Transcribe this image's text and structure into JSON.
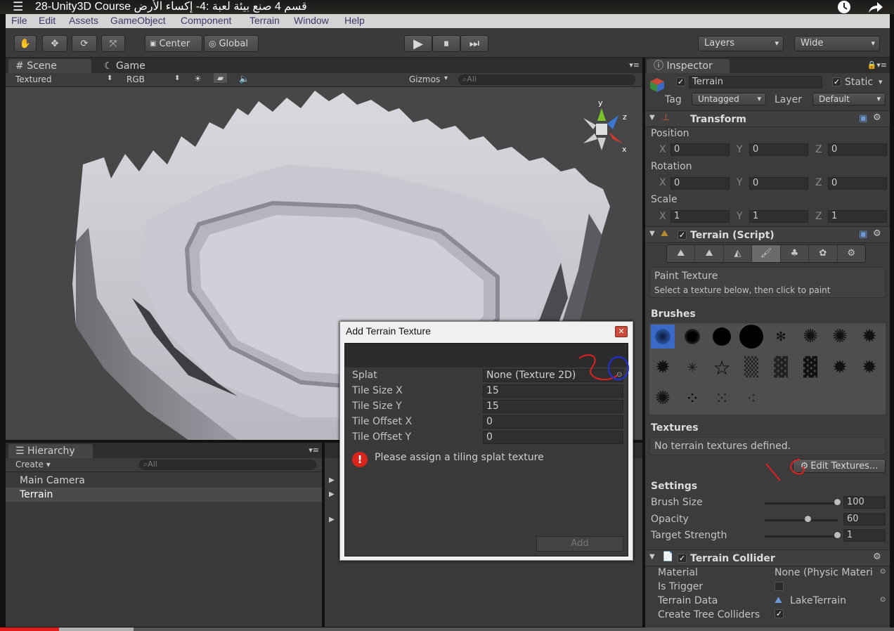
{
  "video": {
    "title": "28-Unity3D Course قسم 4 صنع بيئة لعبة :4- إكساء الأرض"
  },
  "menu": [
    "File",
    "Edit",
    "Assets",
    "GameObject",
    "Component",
    "Terrain",
    "Window",
    "Help"
  ],
  "toolbar": {
    "pivot": "Center",
    "space": "Global",
    "layers": "Layers",
    "layout": "Wide"
  },
  "scene": {
    "tab_scene": "Scene",
    "tab_game": "Game",
    "render_mode": "Textured",
    "color_mode": "RGB",
    "gizmos": "Gizmos",
    "search_placeholder": "All",
    "axis_y": "y",
    "axis_z": "z",
    "axis_x": "x"
  },
  "hierarchy": {
    "tab": "Hierarchy",
    "create": "Create",
    "search_placeholder": "All",
    "items": [
      "Main Camera",
      "Terrain"
    ],
    "selected": "Terrain"
  },
  "inspector": {
    "tab": "Inspector",
    "object_name": "Terrain",
    "static_label": "Static",
    "tag_label": "Tag",
    "tag_value": "Untagged",
    "layer_label": "Layer",
    "layer_value": "Default",
    "transform": {
      "title": "Transform",
      "position": "Position",
      "rotation": "Rotation",
      "scale": "Scale",
      "pos": [
        "0",
        "0",
        "0"
      ],
      "rot": [
        "0",
        "0",
        "0"
      ],
      "scl": [
        "1",
        "1",
        "1"
      ],
      "x": "X",
      "y": "Y",
      "z": "Z"
    },
    "terrain_script": {
      "title": "Terrain (Script)",
      "paint_title": "Paint Texture",
      "paint_hint": "Select a texture below, then click to paint",
      "brushes": "Brushes",
      "textures": "Textures",
      "no_textures": "No terrain textures defined.",
      "edit_textures": "Edit Textures...",
      "settings": "Settings",
      "brush_size_label": "Brush Size",
      "brush_size": "100",
      "opacity_label": "Opacity",
      "opacity": "60",
      "target_strength_label": "Target Strength",
      "target_strength": "1",
      "brush_size_fraction": 1.0,
      "opacity_fraction": 0.6,
      "target_strength_fraction": 1.0
    },
    "collider": {
      "title": "Terrain Collider",
      "material_label": "Material",
      "material_value": "None (Physic Materi",
      "trigger_label": "Is Trigger",
      "data_label": "Terrain Data",
      "data_value": "LakeTerrain",
      "trees_label": "Create Tree Colliders"
    }
  },
  "dialog": {
    "title": "Add Terrain Texture",
    "rows": [
      {
        "label": "Splat",
        "value": "None (Texture 2D)"
      },
      {
        "label": "Tile Size X",
        "value": "15"
      },
      {
        "label": "Tile Size Y",
        "value": "15"
      },
      {
        "label": "Tile Offset X",
        "value": "0"
      },
      {
        "label": "Tile Offset Y",
        "value": "0"
      }
    ],
    "error": "Please assign a tiling splat texture",
    "add_button": "Add"
  },
  "colors": {
    "accent_selected": "#4a4a4a",
    "error_red": "#d9261c",
    "video_progress": "#e21b1b"
  }
}
